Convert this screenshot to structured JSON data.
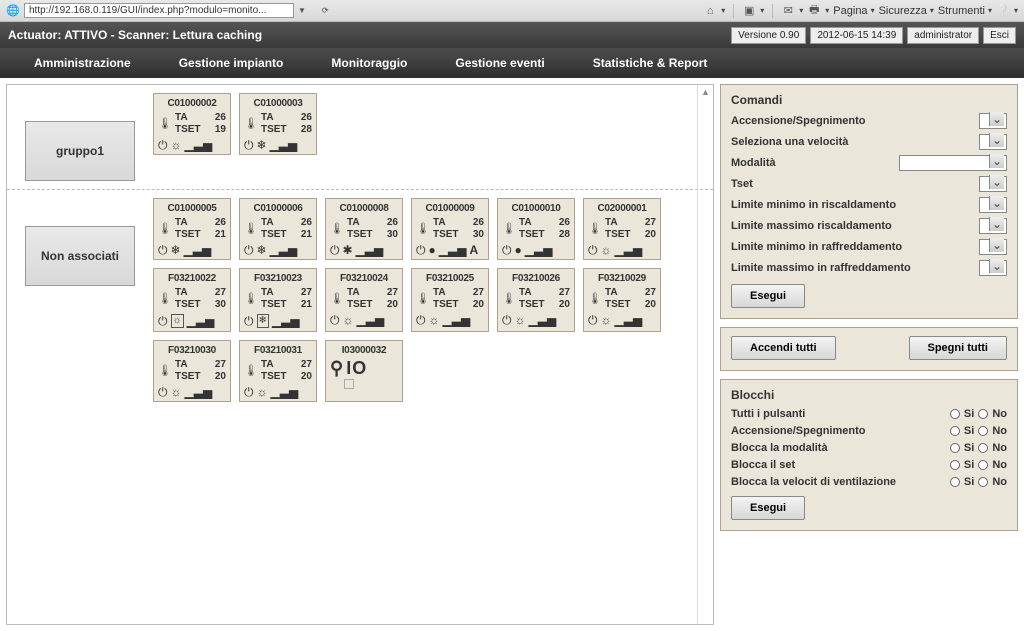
{
  "browser": {
    "url": "http://192.168.0.119/GUI/index.php?modulo=monito...",
    "menu": {
      "pagina": "Pagina",
      "sicurezza": "Sicurezza",
      "strumenti": "Strumenti",
      "help": "?"
    }
  },
  "status": {
    "title": "Actuator: ATTIVO - Scanner: Lettura caching",
    "version": "Versione 0.90",
    "datetime": "2012-06-15 14:39",
    "user": "administrator",
    "logout": "Esci"
  },
  "nav": {
    "admin": "Amministrazione",
    "impianto": "Gestione impianto",
    "monitoraggio": "Monitoraggio",
    "eventi": "Gestione eventi",
    "stat": "Statistiche & Report"
  },
  "groups": [
    {
      "name": "gruppo1",
      "units": [
        {
          "id": "C01000002",
          "ta": "26",
          "tset": "19",
          "mode": "gear"
        },
        {
          "id": "C01000003",
          "ta": "26",
          "tset": "28",
          "mode": "snow"
        }
      ]
    },
    {
      "name": "Non associati",
      "units": [
        {
          "id": "C01000005",
          "ta": "26",
          "tset": "21",
          "mode": "snow"
        },
        {
          "id": "C01000006",
          "ta": "26",
          "tset": "21",
          "mode": "snow"
        },
        {
          "id": "C01000008",
          "ta": "26",
          "tset": "30",
          "mode": "fan"
        },
        {
          "id": "C01000009",
          "ta": "26",
          "tset": "30",
          "mode": "dot",
          "suffix": "A"
        },
        {
          "id": "C01000010",
          "ta": "26",
          "tset": "28",
          "mode": "dot"
        },
        {
          "id": "C02000001",
          "ta": "27",
          "tset": "20",
          "mode": "gear"
        },
        {
          "id": "F03210022",
          "ta": "27",
          "tset": "30",
          "mode": "box-gear"
        },
        {
          "id": "F03210023",
          "ta": "27",
          "tset": "21",
          "mode": "box-snow"
        },
        {
          "id": "F03210024",
          "ta": "27",
          "tset": "20",
          "mode": "gear"
        },
        {
          "id": "F03210025",
          "ta": "27",
          "tset": "20",
          "mode": "gear"
        },
        {
          "id": "F03210026",
          "ta": "27",
          "tset": "20",
          "mode": "gear"
        },
        {
          "id": "F03210029",
          "ta": "27",
          "tset": "20",
          "mode": "gear"
        },
        {
          "id": "F03210030",
          "ta": "27",
          "tset": "20",
          "mode": "gear"
        },
        {
          "id": "F03210031",
          "ta": "27",
          "tset": "20",
          "mode": "gear"
        },
        {
          "id": "I03000032",
          "io": "IO"
        }
      ]
    }
  ],
  "labels": {
    "ta": "TA",
    "tset": "TSET"
  },
  "comandi": {
    "title": "Comandi",
    "rows": {
      "onoff": "Accensione/Spegnimento",
      "speed": "Seleziona una velocità",
      "mode": "Modalità",
      "tset": "Tset",
      "limMinHeat": "Limite minimo in riscaldamento",
      "limMaxHeat": "Limite massimo riscaldamento",
      "limMinCool": "Limite minimo in raffreddamento",
      "limMaxCool": "Limite massimo in raffreddamento"
    },
    "exec": "Esegui",
    "allOn": "Accendi tutti",
    "allOff": "Spegni tutti"
  },
  "blocchi": {
    "title": "Blocchi",
    "rows": {
      "all": "Tutti i pulsanti",
      "onoff": "Accensione/Spegnimento",
      "mode": "Blocca la modalità",
      "set": "Blocca il set",
      "fan": "Blocca la velocit di ventilazione"
    },
    "si": "Si",
    "no": "No",
    "exec": "Esegui"
  }
}
